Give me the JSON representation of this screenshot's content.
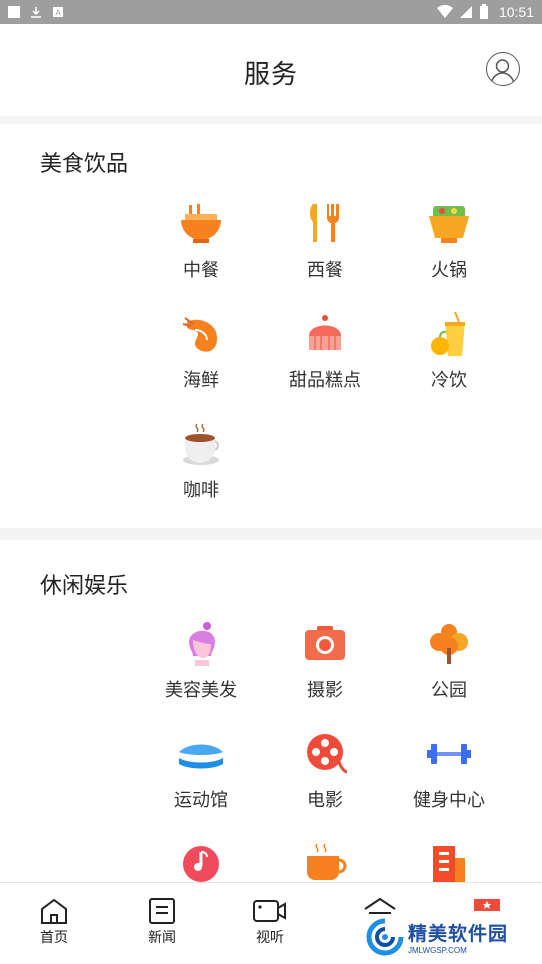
{
  "status_bar": {
    "time": "10:51"
  },
  "header": {
    "title": "服务"
  },
  "sections": [
    {
      "title": "美食饮品",
      "items": [
        {
          "label": "中餐",
          "icon": "noodle-bowl-icon"
        },
        {
          "label": "西餐",
          "icon": "fork-knife-icon"
        },
        {
          "label": "火锅",
          "icon": "hotpot-icon"
        },
        {
          "label": "海鲜",
          "icon": "shrimp-icon"
        },
        {
          "label": "甜品糕点",
          "icon": "cake-icon"
        },
        {
          "label": "冷饮",
          "icon": "cold-drink-icon"
        },
        {
          "label": "咖啡",
          "icon": "coffee-cup-icon"
        }
      ]
    },
    {
      "title": "休闲娱乐",
      "items": [
        {
          "label": "美容美发",
          "icon": "beauty-head-icon"
        },
        {
          "label": "摄影",
          "icon": "camera-icon"
        },
        {
          "label": "公园",
          "icon": "tree-icon"
        },
        {
          "label": "运动馆",
          "icon": "stadium-icon"
        },
        {
          "label": "电影",
          "icon": "film-reel-icon"
        },
        {
          "label": "健身中心",
          "icon": "dumbbell-icon"
        },
        {
          "label": "",
          "icon": "music-note-icon"
        },
        {
          "label": "",
          "icon": "tea-cup-icon"
        },
        {
          "label": "",
          "icon": "building-icon"
        }
      ]
    }
  ],
  "bottom_nav": [
    {
      "label": "首页",
      "icon": "home-icon"
    },
    {
      "label": "新闻",
      "icon": "news-icon"
    },
    {
      "label": "视听",
      "icon": "video-icon"
    },
    {
      "label": "",
      "icon": "service-icon"
    },
    {
      "label": "",
      "icon": "profile-icon"
    }
  ],
  "watermark": {
    "text": "精美软件园",
    "sub": "JMLWGSP.COM"
  },
  "colors": {
    "accent_orange": "#f5821f",
    "accent_red": "#f04b3a",
    "accent_blue": "#2f6fe0",
    "nav_text": "#222222"
  }
}
